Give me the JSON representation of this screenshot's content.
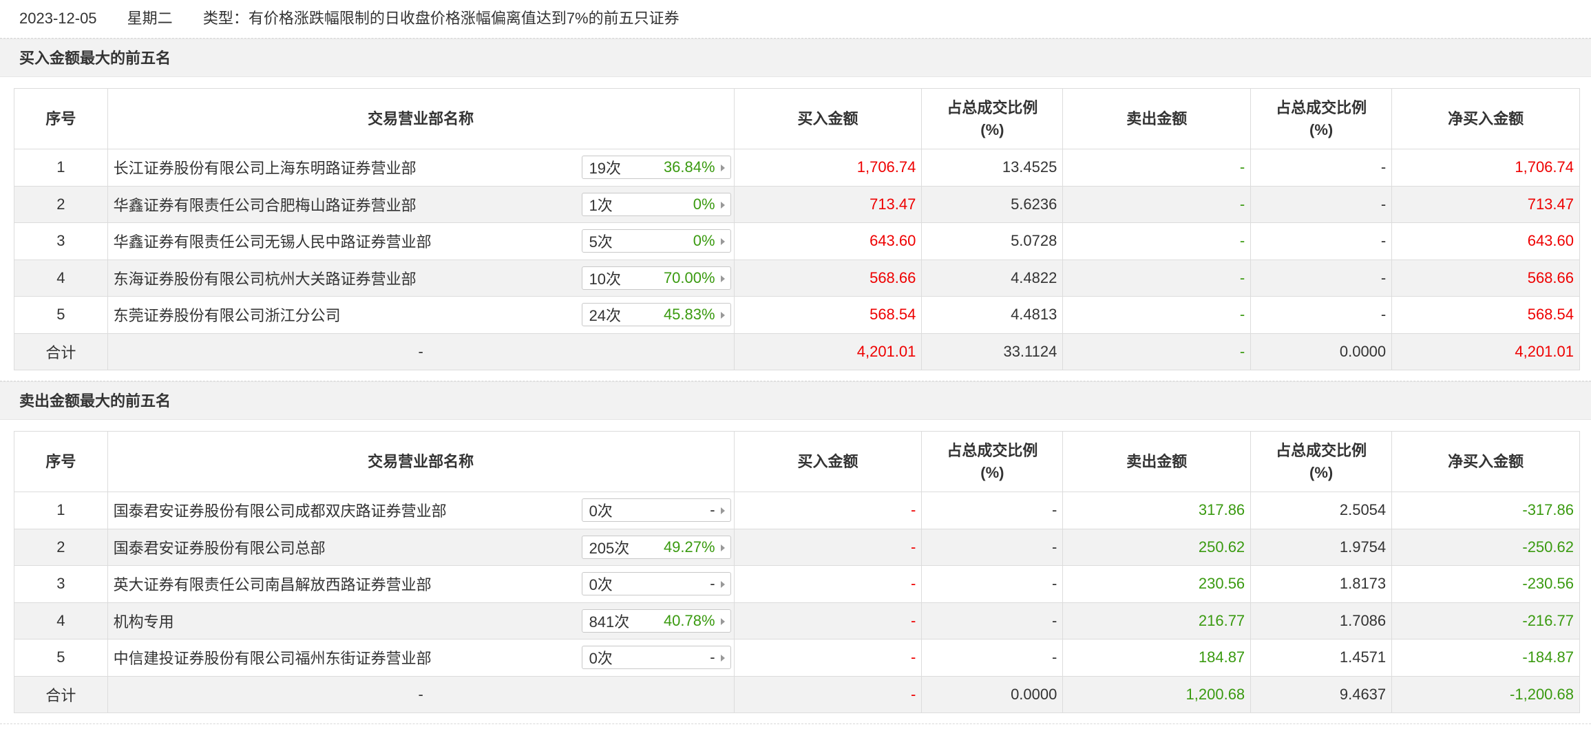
{
  "header": {
    "date": "2023-12-05",
    "weekday": "星期二",
    "type_text": "类型：有价格涨跌幅限制的日收盘价格涨幅偏离值达到7%的前五只证券"
  },
  "columns": {
    "seq": "序号",
    "name": "交易营业部名称",
    "buy": "买入金额",
    "buy_ratio_line1": "占总成交比例",
    "buy_ratio_line2": "(%)",
    "sell": "卖出金额",
    "sell_ratio_line1": "占总成交比例",
    "sell_ratio_line2": "(%)",
    "net": "净买入金额"
  },
  "buy_section": {
    "title": "买入金额最大的前五名",
    "rows": [
      {
        "seq": "1",
        "name": "长江证券股份有限公司上海东明路证券营业部",
        "count": "19次",
        "pct": "36.84%",
        "buy": "1,706.74",
        "buy_ratio": "13.4525",
        "sell": "-",
        "sell_ratio": "-",
        "net": "1,706.74"
      },
      {
        "seq": "2",
        "name": "华鑫证券有限责任公司合肥梅山路证券营业部",
        "count": "1次",
        "pct": "0%",
        "buy": "713.47",
        "buy_ratio": "5.6236",
        "sell": "-",
        "sell_ratio": "-",
        "net": "713.47"
      },
      {
        "seq": "3",
        "name": "华鑫证券有限责任公司无锡人民中路证券营业部",
        "count": "5次",
        "pct": "0%",
        "buy": "643.60",
        "buy_ratio": "5.0728",
        "sell": "-",
        "sell_ratio": "-",
        "net": "643.60"
      },
      {
        "seq": "4",
        "name": "东海证券股份有限公司杭州大关路证券营业部",
        "count": "10次",
        "pct": "70.00%",
        "buy": "568.66",
        "buy_ratio": "4.4822",
        "sell": "-",
        "sell_ratio": "-",
        "net": "568.66"
      },
      {
        "seq": "5",
        "name": "东莞证券股份有限公司浙江分公司",
        "count": "24次",
        "pct": "45.83%",
        "buy": "568.54",
        "buy_ratio": "4.4813",
        "sell": "-",
        "sell_ratio": "-",
        "net": "568.54"
      }
    ],
    "total": {
      "label": "合计",
      "name": "-",
      "buy": "4,201.01",
      "buy_ratio": "33.1124",
      "sell": "-",
      "sell_ratio": "0.0000",
      "net": "4,201.01"
    }
  },
  "sell_section": {
    "title": "卖出金额最大的前五名",
    "rows": [
      {
        "seq": "1",
        "name": "国泰君安证券股份有限公司成都双庆路证券营业部",
        "count": "0次",
        "pct": "-",
        "buy": "-",
        "buy_ratio": "-",
        "sell": "317.86",
        "sell_ratio": "2.5054",
        "net": "-317.86"
      },
      {
        "seq": "2",
        "name": "国泰君安证券股份有限公司总部",
        "count": "205次",
        "pct": "49.27%",
        "buy": "-",
        "buy_ratio": "-",
        "sell": "250.62",
        "sell_ratio": "1.9754",
        "net": "-250.62"
      },
      {
        "seq": "3",
        "name": "英大证券有限责任公司南昌解放西路证券营业部",
        "count": "0次",
        "pct": "-",
        "buy": "-",
        "buy_ratio": "-",
        "sell": "230.56",
        "sell_ratio": "1.8173",
        "net": "-230.56"
      },
      {
        "seq": "4",
        "name": "机构专用",
        "count": "841次",
        "pct": "40.78%",
        "buy": "-",
        "buy_ratio": "-",
        "sell": "216.77",
        "sell_ratio": "1.7086",
        "net": "-216.77"
      },
      {
        "seq": "5",
        "name": "中信建投证券股份有限公司福州东街证券营业部",
        "count": "0次",
        "pct": "-",
        "buy": "-",
        "buy_ratio": "-",
        "sell": "184.87",
        "sell_ratio": "1.4571",
        "net": "-184.87"
      }
    ],
    "total": {
      "label": "合计",
      "name": "-",
      "buy": "-",
      "buy_ratio": "0.0000",
      "sell": "1,200.68",
      "sell_ratio": "9.4637",
      "net": "-1,200.68"
    }
  },
  "colors": {
    "positive": "#ee0000",
    "negative": "#3a9a10",
    "header_bg": "#f2f2f2"
  }
}
